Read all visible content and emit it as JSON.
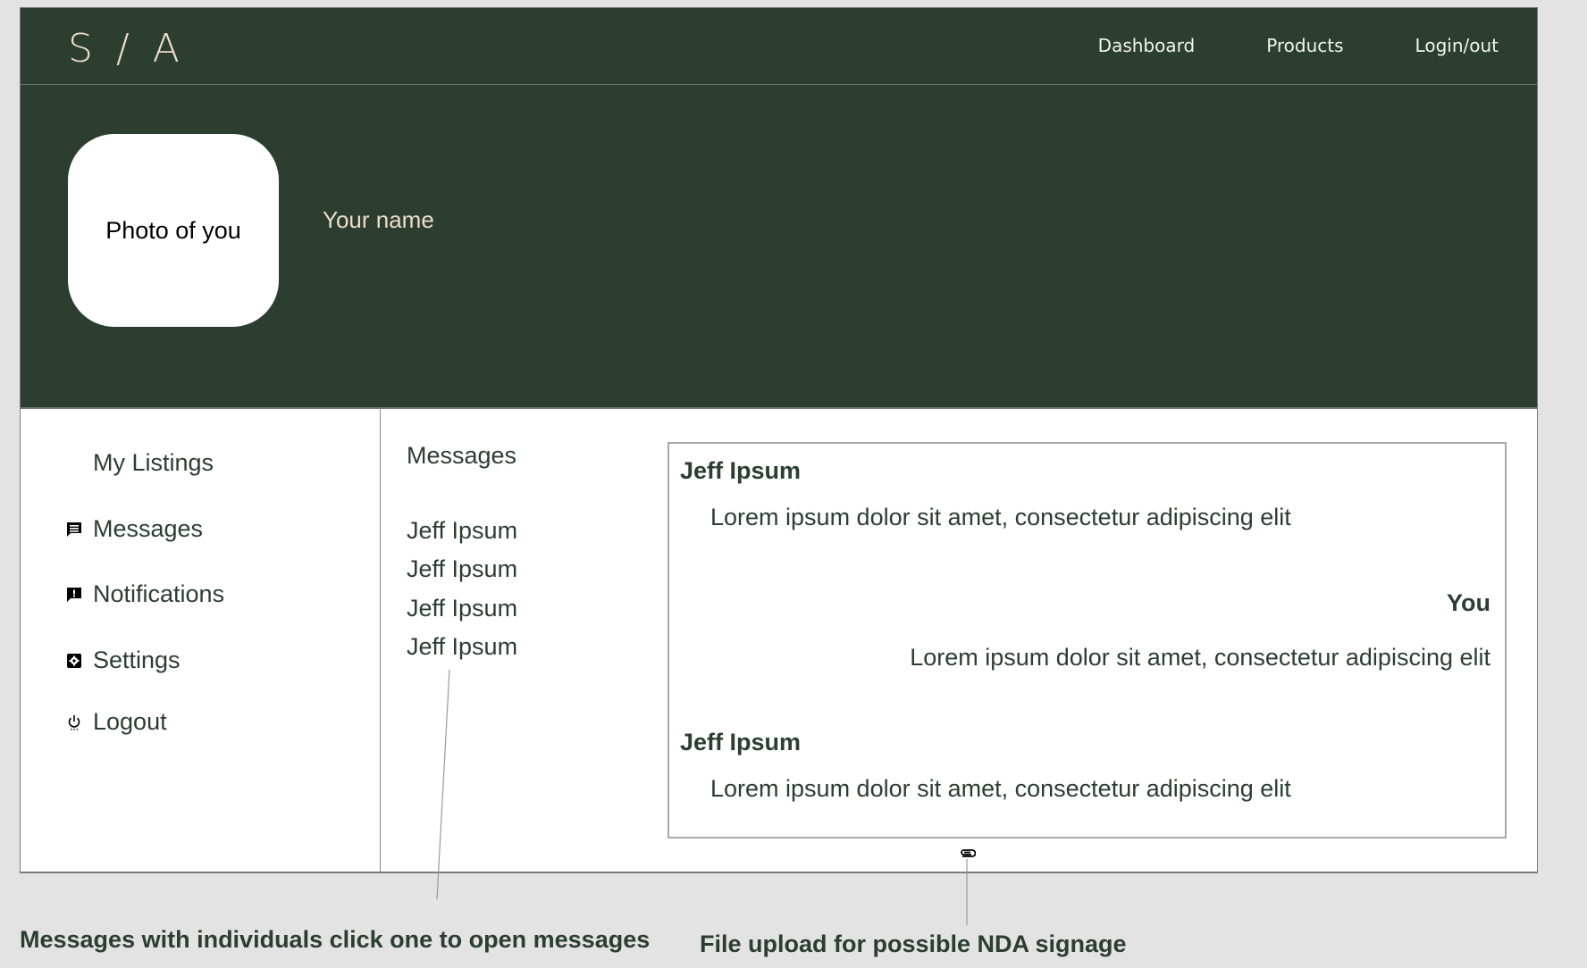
{
  "brand": {
    "logo": "S / A"
  },
  "nav": {
    "links": [
      {
        "label": "Dashboard"
      },
      {
        "label": "Products"
      },
      {
        "label": "Login/out"
      }
    ]
  },
  "profile": {
    "photo_placeholder": "Photo of you",
    "name": "Your name"
  },
  "sidebar": {
    "items": [
      {
        "label": "My Listings",
        "icon": "none"
      },
      {
        "label": "Messages",
        "icon": "message-icon"
      },
      {
        "label": "Notifications",
        "icon": "notification-icon"
      },
      {
        "label": "Settings",
        "icon": "settings-icon"
      },
      {
        "label": "Logout",
        "icon": "power-icon"
      }
    ]
  },
  "messages": {
    "title": "Messages",
    "contacts": [
      {
        "name": "Jeff Ipsum"
      },
      {
        "name": "Jeff Ipsum"
      },
      {
        "name": "Jeff Ipsum"
      },
      {
        "name": "Jeff Ipsum"
      }
    ]
  },
  "conversation": {
    "messages": [
      {
        "sender": "Jeff Ipsum",
        "text": "Lorem ipsum dolor sit amet, consectetur adipiscing elit",
        "align": "left"
      },
      {
        "sender": "You",
        "text": "Lorem ipsum dolor sit amet, consectetur adipiscing elit",
        "align": "right"
      },
      {
        "sender": "Jeff Ipsum",
        "text": "Lorem ipsum dolor sit amet, consectetur adipiscing elit",
        "align": "left"
      }
    ],
    "attachment_icon": "paperclip-icon"
  },
  "annotations": {
    "contacts_note": "Messages with individuals click one to open messages",
    "upload_note": "File upload for possible NDA signage"
  },
  "colors": {
    "brand_dark": "#2c3e30",
    "accent_cream": "#ecdccb",
    "page_bg": "#e3e3e3"
  }
}
